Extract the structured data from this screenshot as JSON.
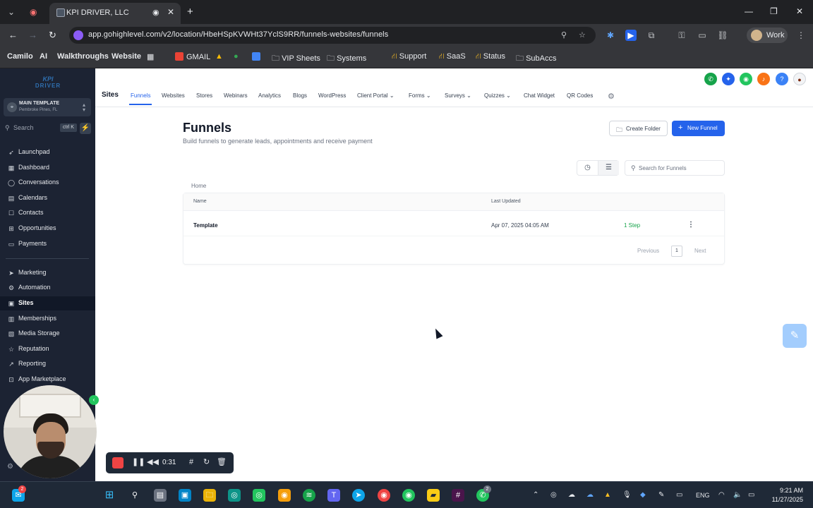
{
  "browser": {
    "tab_title": "KPI DRIVER, LLC",
    "url": "app.gohighlevel.com/v2/location/HbeHSpKVWHt37YclS9RR/funnels-websites/funnels",
    "profile_label": "Work",
    "bookmarks": [
      "Camilo",
      "AI",
      "Walkthroughs",
      "Website",
      "GMAIL",
      "VIP Sheets",
      "Systems",
      "Support",
      "SaaS",
      "Status",
      "SubAccs"
    ]
  },
  "sidebar": {
    "logo_top": "KPI",
    "logo_bottom": "DRIVER",
    "account_name": "MAIN TEMPLATE",
    "account_location": "Pembroke Pines, FL",
    "search_label": "Search",
    "search_shortcut": "ctrl K",
    "items": [
      {
        "label": "Launchpad",
        "icon": "rocket-icon"
      },
      {
        "label": "Dashboard",
        "icon": "dashboard-icon"
      },
      {
        "label": "Conversations",
        "icon": "chat-icon"
      },
      {
        "label": "Calendars",
        "icon": "calendar-icon"
      },
      {
        "label": "Contacts",
        "icon": "contacts-icon"
      },
      {
        "label": "Opportunities",
        "icon": "opportunities-icon"
      },
      {
        "label": "Payments",
        "icon": "payments-icon"
      },
      {
        "label": "Marketing",
        "icon": "marketing-icon"
      },
      {
        "label": "Automation",
        "icon": "automation-icon"
      },
      {
        "label": "Sites",
        "icon": "sites-icon",
        "active": true
      },
      {
        "label": "Memberships",
        "icon": "memberships-icon"
      },
      {
        "label": "Media Storage",
        "icon": "media-icon"
      },
      {
        "label": "Reputation",
        "icon": "star-icon"
      },
      {
        "label": "Reporting",
        "icon": "reporting-icon"
      },
      {
        "label": "App Marketplace",
        "icon": "marketplace-icon"
      }
    ]
  },
  "recorder": {
    "time": "0:31"
  },
  "header": {
    "section_title": "Sites",
    "tabs": [
      "Funnels",
      "Websites",
      "Stores",
      "Webinars",
      "Analytics",
      "Blogs",
      "WordPress",
      "Client Portal",
      "Forms",
      "Surveys",
      "Quizzes",
      "Chat Widget",
      "QR Codes"
    ],
    "active_tab": "Funnels",
    "icon_colors": [
      "#16a34a",
      "#2563eb",
      "#22c55e",
      "#f97316",
      "#3b82f6"
    ]
  },
  "page": {
    "title": "Funnels",
    "subtitle": "Build funnels to generate leads, appointments and receive payment",
    "create_folder_label": "Create Folder",
    "new_funnel_label": "New Funnel",
    "search_placeholder": "Search for Funnels",
    "breadcrumb": "Home",
    "columns": {
      "name": "Name",
      "last_updated": "Last Updated"
    },
    "rows": [
      {
        "name": "Template",
        "last_updated": "Apr 07, 2025 04:05 AM",
        "steps": "1 Step"
      }
    ],
    "pagination": {
      "previous": "Previous",
      "current": "1",
      "next": "Next"
    }
  },
  "taskbar": {
    "mail_badge": "2",
    "whatsapp_badge": "2",
    "language": "ENG",
    "time": "9:21 AM",
    "date": "11/27/2025"
  },
  "colors": {
    "accent": "#2563eb",
    "sidebar_bg": "#1c2333",
    "steps_green": "#16a34a"
  }
}
